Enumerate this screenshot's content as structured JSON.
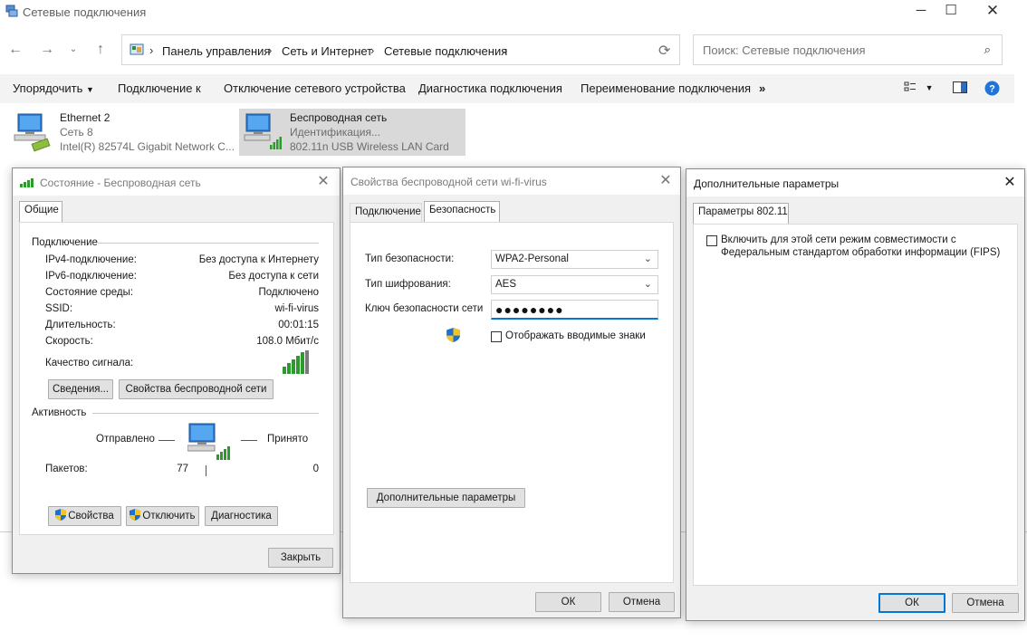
{
  "explorer": {
    "title": "Сетевые подключения",
    "breadcrumb": [
      "Панель управления",
      "Сеть и Интернет",
      "Сетевые подключения"
    ],
    "search_placeholder": "Поиск: Сетевые подключения",
    "commands": [
      "Упорядочить",
      "Подключение к",
      "Отключение сетевого устройства",
      "Диагностика подключения",
      "Переименование подключения"
    ],
    "more": "»",
    "items": [
      {
        "name": "Ethernet 2",
        "status": "Сеть 8",
        "device": "Intel(R) 82574L Gigabit Network C..."
      },
      {
        "name": "Беспроводная сеть",
        "status": "Идентификация...",
        "device": "802.11n USB Wireless LAN Card"
      }
    ],
    "colors": {
      "accent": "#0078d7",
      "selected_bg": "#d9d9d9",
      "cmdbar_bg": "#f3f3f3"
    }
  },
  "status_dialog": {
    "title": "Состояние - Беспроводная сеть",
    "tab": "Общие",
    "group_connection": "Подключение",
    "rows": [
      {
        "label": "IPv4-подключение:",
        "value": "Без доступа к Интернету"
      },
      {
        "label": "IPv6-подключение:",
        "value": "Без доступа к сети"
      },
      {
        "label": "Состояние среды:",
        "value": "Подключено"
      },
      {
        "label": "SSID:",
        "value": "wi-fi-virus"
      },
      {
        "label": "Длительность:",
        "value": "00:01:15"
      },
      {
        "label": "Скорость:",
        "value": "108.0 Мбит/с"
      }
    ],
    "signal_label": "Качество сигнала:",
    "details_button": "Сведения...",
    "wireless_props_button": "Свойства беспроводной сети",
    "group_activity": "Активность",
    "sent_label": "Отправлено",
    "received_label": "Принято",
    "packets_label": "Пакетов:",
    "packets_sent": "77",
    "packets_received": "0",
    "props_button": "Свойства",
    "disable_button": "Отключить",
    "diagnose_button": "Диагностика",
    "close_button": "Закрыть"
  },
  "props_dialog": {
    "title": "Свойства беспроводной сети wi-fi-virus",
    "tabs": [
      "Подключение",
      "Безопасность"
    ],
    "security_type_label": "Тип безопасности:",
    "security_type_value": "WPA2-Personal",
    "encryption_label": "Тип шифрования:",
    "encryption_value": "AES",
    "key_label": "Ключ безопасности сети",
    "key_value": "●●●●●●●●",
    "show_chars_label": "Отображать вводимые знаки",
    "advanced_button": "Дополнительные параметры",
    "ok_button": "ОК",
    "cancel_button": "Отмена"
  },
  "advanced_dialog": {
    "title": "Дополнительные параметры",
    "tab": "Параметры 802.11",
    "fips_label_line1": "Включить для этой сети режим совместимости с",
    "fips_label_line2": "Федеральным стандартом обработки информации (FIPS)",
    "ok_button": "ОК",
    "cancel_button": "Отмена"
  },
  "icons": [
    "network-connections-icon",
    "back-arrow-icon",
    "forward-arrow-icon",
    "recent-chevron-icon",
    "up-arrow-icon",
    "control-panel-icon",
    "refresh-icon",
    "search-icon",
    "view-options-icon",
    "preview-pane-icon",
    "help-icon",
    "ethernet-adapter-icon",
    "wireless-adapter-icon",
    "signal-bars-icon",
    "shield-icon",
    "close-icon"
  ]
}
